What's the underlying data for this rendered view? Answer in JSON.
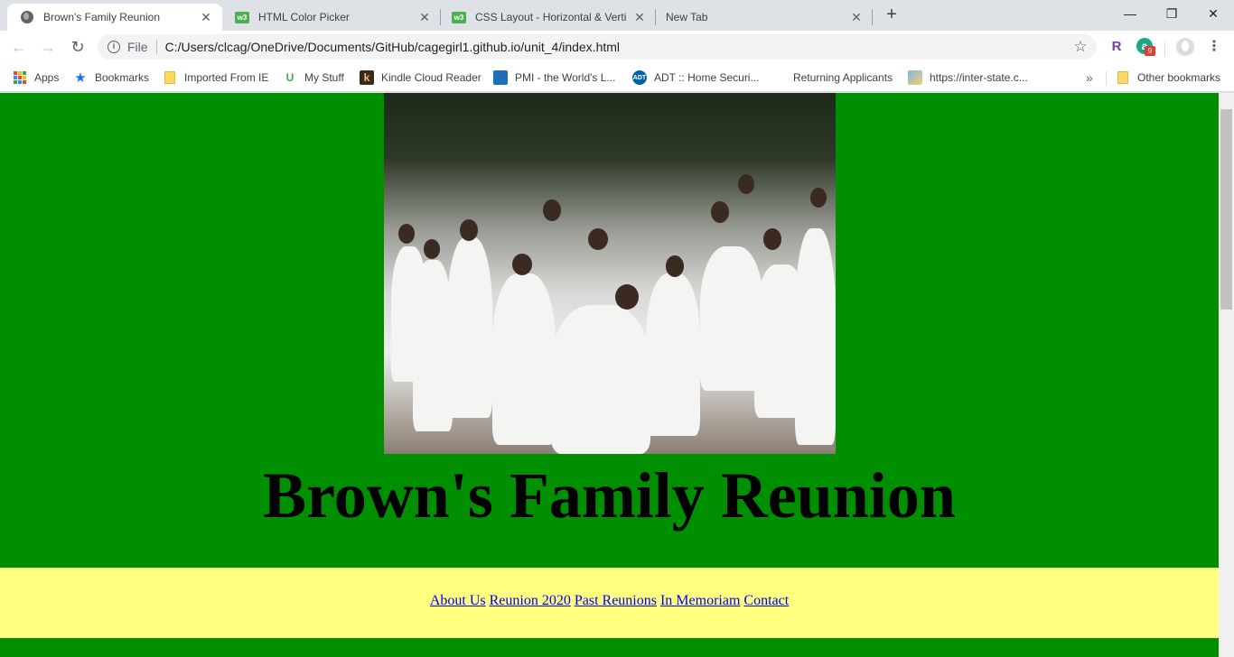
{
  "browser": {
    "tabs": [
      {
        "title": "Brown's Family Reunion",
        "icon": "globe-icon",
        "active": true
      },
      {
        "title": "HTML Color Picker",
        "icon": "w3schools-icon",
        "active": false
      },
      {
        "title": "CSS Layout - Horizontal & Vertic",
        "icon": "w3schools-icon",
        "active": false
      },
      {
        "title": "New Tab",
        "icon": "",
        "active": false
      }
    ],
    "address": {
      "scheme": "File",
      "url": "C:/Users/clcag/OneDrive/Documents/GitHub/cagegirl1.github.io/unit_4/index.html"
    },
    "bookmarks": [
      {
        "label": "Apps",
        "icon": "apps-grid-icon"
      },
      {
        "label": "Bookmarks",
        "icon": "star-icon"
      },
      {
        "label": "Imported From IE",
        "icon": "folder-icon"
      },
      {
        "label": "My Stuff",
        "icon": "u-logo-icon"
      },
      {
        "label": "Kindle Cloud Reader",
        "icon": "kindle-icon"
      },
      {
        "label": "PMI - the World's L...",
        "icon": "pmi-icon"
      },
      {
        "label": "ADT :: Home Securi...",
        "icon": "adt-icon"
      },
      {
        "label": "Returning Applicants",
        "icon": ""
      },
      {
        "label": "https://inter-state.c...",
        "icon": "image-icon"
      }
    ],
    "bookmarks_overflow": "»",
    "other_bookmarks": "Other bookmarks"
  },
  "page": {
    "title": "Brown's Family Reunion",
    "nav_links": [
      "About Us",
      "Reunion 2020",
      "Past Reunions",
      "In Memoriam",
      "Contact"
    ]
  },
  "colors": {
    "page_background": "#008f00",
    "nav_background": "#ffff80",
    "link": "#0000ee"
  }
}
